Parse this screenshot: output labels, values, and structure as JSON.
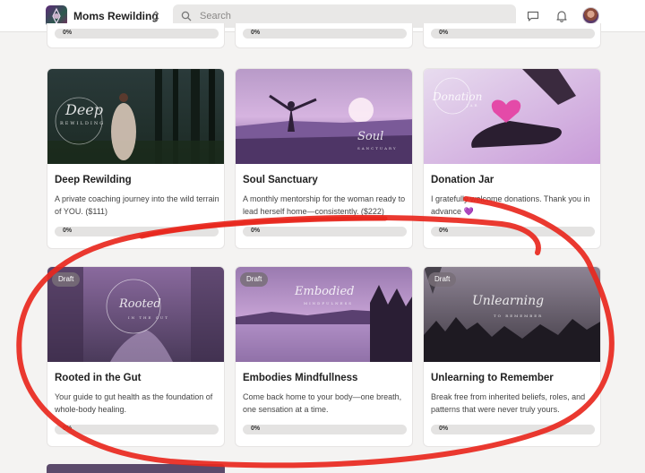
{
  "app": {
    "name": "Moms Rewilding",
    "search_placeholder": "Search"
  },
  "icons": {
    "switcher": "chevron-up-down-icon",
    "search": "search-icon",
    "chat": "chat-bubble-icon",
    "notifications": "bell-icon",
    "avatar": "user-avatar"
  },
  "top_row_stubs": [
    {
      "progress_label": "0%"
    },
    {
      "progress_label": "0%"
    },
    {
      "progress_label": "0%"
    }
  ],
  "row1": [
    {
      "image_text": "Deep",
      "image_subtext": "REWILDING",
      "title": "Deep Rewilding",
      "description": "A private coaching journey into the wild terrain of YOU. ($111)",
      "progress": 0,
      "progress_label": "0%"
    },
    {
      "image_text": "Soul",
      "image_subtext": "SANCTUARY",
      "title": "Soul Sanctuary",
      "description": "A monthly mentorship for the woman ready to lead herself home—consistently. ($222)",
      "progress": 0,
      "progress_label": "0%"
    },
    {
      "image_text": "Donation",
      "image_subtext": "JAR",
      "title": "Donation Jar",
      "description": "I gratefully welcome donations. Thank you in advance 💜",
      "progress": 0,
      "progress_label": "0%"
    }
  ],
  "row2": [
    {
      "badge": "Draft",
      "image_text": "Rooted",
      "image_subtext": "IN THE GUT",
      "title": "Rooted in the Gut",
      "description": "Your guide to gut health as the foundation of whole-body healing.",
      "progress": 0,
      "progress_label": "0%"
    },
    {
      "badge": "Draft",
      "image_text": "Embodied",
      "image_subtext": "MINDFULNESS",
      "title": "Embodies Mindfullness",
      "description": "Come back home to your body—one breath, one sensation at a time.",
      "progress": 0,
      "progress_label": "0%"
    },
    {
      "badge": "Draft",
      "image_text": "Unlearning",
      "image_subtext": "TO REMEMBER",
      "title": "Unlearning to Remember",
      "description": "Break free from inherited beliefs, roles, and patterns that were never truly yours.",
      "progress": 0,
      "progress_label": "0%"
    }
  ],
  "colors": {
    "annotation": "#e8281e",
    "accent": "#6b3d8a"
  }
}
